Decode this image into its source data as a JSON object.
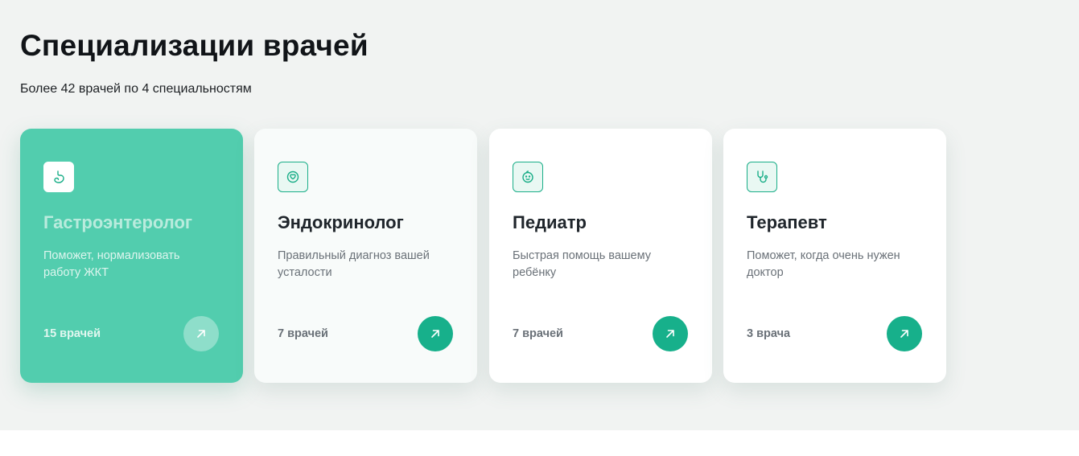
{
  "header": {
    "title": "Специализации врачей",
    "subtitle": "Более 42 врачей по 4 специальностям"
  },
  "colors": {
    "accent": "#17b08b",
    "active_card": "#52cdae",
    "section_bg": "#f1f3f2"
  },
  "cards": [
    {
      "icon": "stomach-icon",
      "title": "Гастроэнтеролог",
      "description": "Поможет, нормализовать работу ЖКТ",
      "count": "15 врачей",
      "state": "active"
    },
    {
      "icon": "thyroid-icon",
      "title": "Эндокринолог",
      "description": "Правильный диагноз вашей усталости",
      "count": "7 врачей",
      "state": "hover"
    },
    {
      "icon": "baby-face-icon",
      "title": "Педиатр",
      "description": "Быстрая помощь вашему ребёнку",
      "count": "7 врачей",
      "state": "default"
    },
    {
      "icon": "stethoscope-icon",
      "title": "Терапевт",
      "description": "Поможет, когда очень нужен доктор",
      "count": "3 врача",
      "state": "default"
    }
  ]
}
